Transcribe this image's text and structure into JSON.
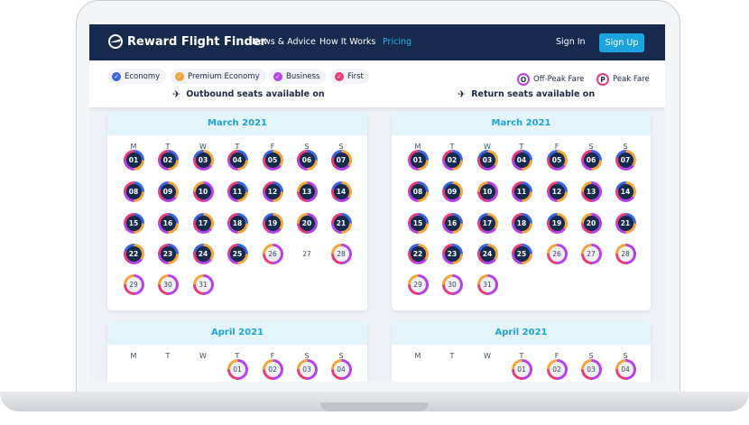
{
  "nav": {
    "brand": "Reward Flight Finder",
    "links": [
      "News & Advice",
      "How It Works",
      "Pricing"
    ],
    "signin": "Sign In",
    "signup": "Sign Up"
  },
  "filters": [
    {
      "label": "Economy",
      "color": "#3a63e0"
    },
    {
      "label": "Premium Economy",
      "color": "#f2a53a"
    },
    {
      "label": "Business",
      "color": "#b542e6"
    },
    {
      "label": "First",
      "color": "#e93b78"
    }
  ],
  "legend": {
    "offpeak_badge": "O",
    "offpeak_label": "Off-Peak Fare",
    "peak_badge": "P",
    "peak_label": "Peak Fare"
  },
  "outbound_label": "Outbound seats available on",
  "return_label": "Return seats available on",
  "weekdays": [
    "M",
    "T",
    "W",
    "T",
    "F",
    "S",
    "S"
  ],
  "calendars": {
    "outbound_march": {
      "title": "March 2021",
      "days": [
        {
          "d": "01",
          "s": "a"
        },
        {
          "d": "02",
          "s": "a"
        },
        {
          "d": "03",
          "s": "b"
        },
        {
          "d": "04",
          "s": "a"
        },
        {
          "d": "05",
          "s": "b"
        },
        {
          "d": "06",
          "s": "a"
        },
        {
          "d": "07",
          "s": "b"
        },
        {
          "d": "08",
          "s": "a"
        },
        {
          "d": "09",
          "s": "b"
        },
        {
          "d": "10",
          "s": "c"
        },
        {
          "d": "11",
          "s": "a"
        },
        {
          "d": "12",
          "s": "a"
        },
        {
          "d": "13",
          "s": "c"
        },
        {
          "d": "14",
          "s": "b"
        },
        {
          "d": "15",
          "s": "a"
        },
        {
          "d": "16",
          "s": "a"
        },
        {
          "d": "17",
          "s": "b"
        },
        {
          "d": "18",
          "s": "a"
        },
        {
          "d": "19",
          "s": "b"
        },
        {
          "d": "20",
          "s": "c"
        },
        {
          "d": "21",
          "s": "a"
        },
        {
          "d": "22",
          "s": "b"
        },
        {
          "d": "23",
          "s": "a"
        },
        {
          "d": "24",
          "s": "b"
        },
        {
          "d": "25",
          "s": "a"
        },
        {
          "d": "26",
          "s": "light"
        },
        {
          "d": "27",
          "s": "plain"
        },
        {
          "d": "28",
          "s": "light"
        },
        {
          "d": "29",
          "s": "light"
        },
        {
          "d": "30",
          "s": "light"
        },
        {
          "d": "31",
          "s": "light"
        }
      ]
    },
    "return_march": {
      "title": "March 2021",
      "days": [
        {
          "d": "01",
          "s": "a"
        },
        {
          "d": "02",
          "s": "a"
        },
        {
          "d": "03",
          "s": "b"
        },
        {
          "d": "04",
          "s": "a"
        },
        {
          "d": "05",
          "s": "b"
        },
        {
          "d": "06",
          "s": "a"
        },
        {
          "d": "07",
          "s": "b"
        },
        {
          "d": "08",
          "s": "a"
        },
        {
          "d": "09",
          "s": "b"
        },
        {
          "d": "10",
          "s": "c"
        },
        {
          "d": "11",
          "s": "a"
        },
        {
          "d": "12",
          "s": "a"
        },
        {
          "d": "13",
          "s": "c"
        },
        {
          "d": "14",
          "s": "b"
        },
        {
          "d": "15",
          "s": "a"
        },
        {
          "d": "16",
          "s": "a"
        },
        {
          "d": "17",
          "s": "b"
        },
        {
          "d": "18",
          "s": "a"
        },
        {
          "d": "19",
          "s": "b"
        },
        {
          "d": "20",
          "s": "c"
        },
        {
          "d": "21",
          "s": "a"
        },
        {
          "d": "22",
          "s": "b"
        },
        {
          "d": "23",
          "s": "a"
        },
        {
          "d": "24",
          "s": "b"
        },
        {
          "d": "25",
          "s": "a"
        },
        {
          "d": "26",
          "s": "light"
        },
        {
          "d": "27",
          "s": "light"
        },
        {
          "d": "28",
          "s": "light"
        },
        {
          "d": "29",
          "s": "light"
        },
        {
          "d": "30",
          "s": "light"
        },
        {
          "d": "31",
          "s": "light"
        }
      ]
    },
    "outbound_april": {
      "title": "April 2021",
      "days": [
        {
          "d": "",
          "s": "none"
        },
        {
          "d": "",
          "s": "none"
        },
        {
          "d": "",
          "s": "none"
        },
        {
          "d": "01",
          "s": "light"
        },
        {
          "d": "02",
          "s": "light"
        },
        {
          "d": "03",
          "s": "light"
        },
        {
          "d": "04",
          "s": "light"
        }
      ]
    },
    "return_april": {
      "title": "April 2021",
      "days": [
        {
          "d": "",
          "s": "none"
        },
        {
          "d": "",
          "s": "none"
        },
        {
          "d": "",
          "s": "none"
        },
        {
          "d": "01",
          "s": "light"
        },
        {
          "d": "02",
          "s": "light"
        },
        {
          "d": "03",
          "s": "light"
        },
        {
          "d": "04",
          "s": "light"
        }
      ]
    }
  }
}
